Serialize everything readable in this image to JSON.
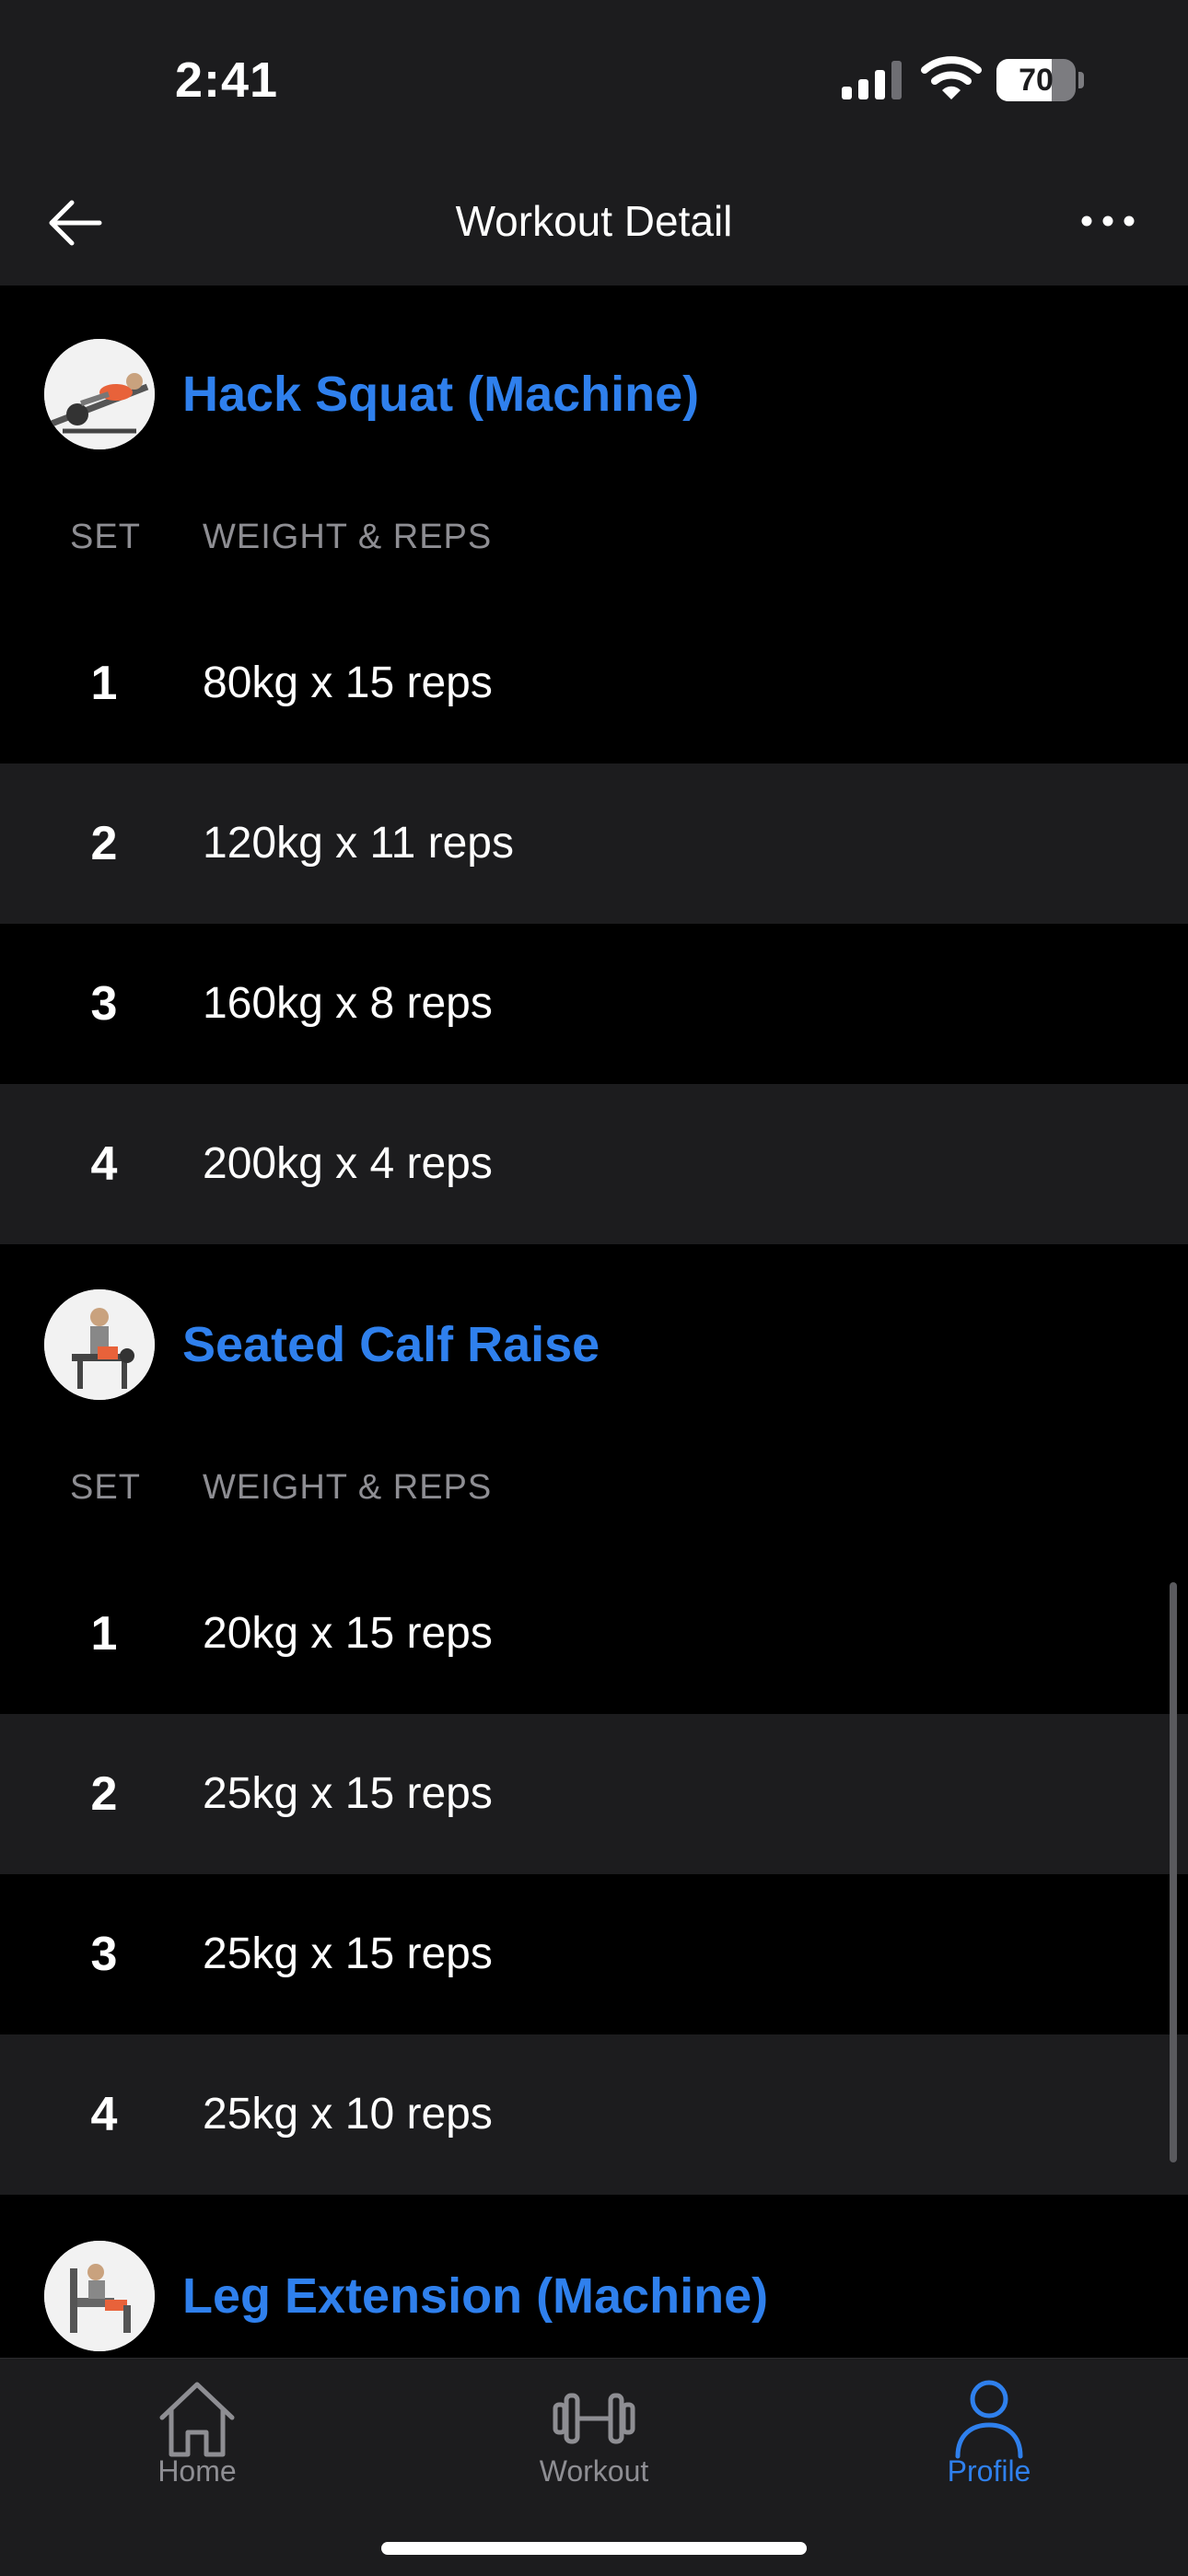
{
  "status_bar": {
    "time": "2:41",
    "battery_level": "70",
    "battery_fraction": 0.7
  },
  "nav": {
    "title": "Workout Detail",
    "back_icon": "arrow-left-icon",
    "more_icon": "ellipsis-icon"
  },
  "columns": {
    "set": "SET",
    "weight_reps": "WEIGHT & REPS"
  },
  "exercises": [
    {
      "name": "Hack Squat (Machine)",
      "sets": [
        {
          "set": "1",
          "value": "80kg x 15 reps"
        },
        {
          "set": "2",
          "value": "120kg x 11 reps"
        },
        {
          "set": "3",
          "value": "160kg x 8 reps"
        },
        {
          "set": "4",
          "value": "200kg x 4 reps"
        }
      ]
    },
    {
      "name": "Seated Calf Raise",
      "sets": [
        {
          "set": "1",
          "value": "20kg x 15 reps"
        },
        {
          "set": "2",
          "value": "25kg x 15 reps"
        },
        {
          "set": "3",
          "value": "25kg x 15 reps"
        },
        {
          "set": "4",
          "value": "25kg x 10 reps"
        }
      ]
    },
    {
      "name": "Leg Extension (Machine)"
    }
  ],
  "tabs": [
    {
      "label": "Home",
      "icon": "home-icon"
    },
    {
      "label": "Workout",
      "icon": "dumbbell-icon"
    },
    {
      "label": "Profile",
      "icon": "person-icon",
      "active": true
    }
  ],
  "colors": {
    "accent": "#2f80ed",
    "background": "#000000",
    "surface": "#1c1c1e",
    "muted_text": "#8e8e93"
  }
}
